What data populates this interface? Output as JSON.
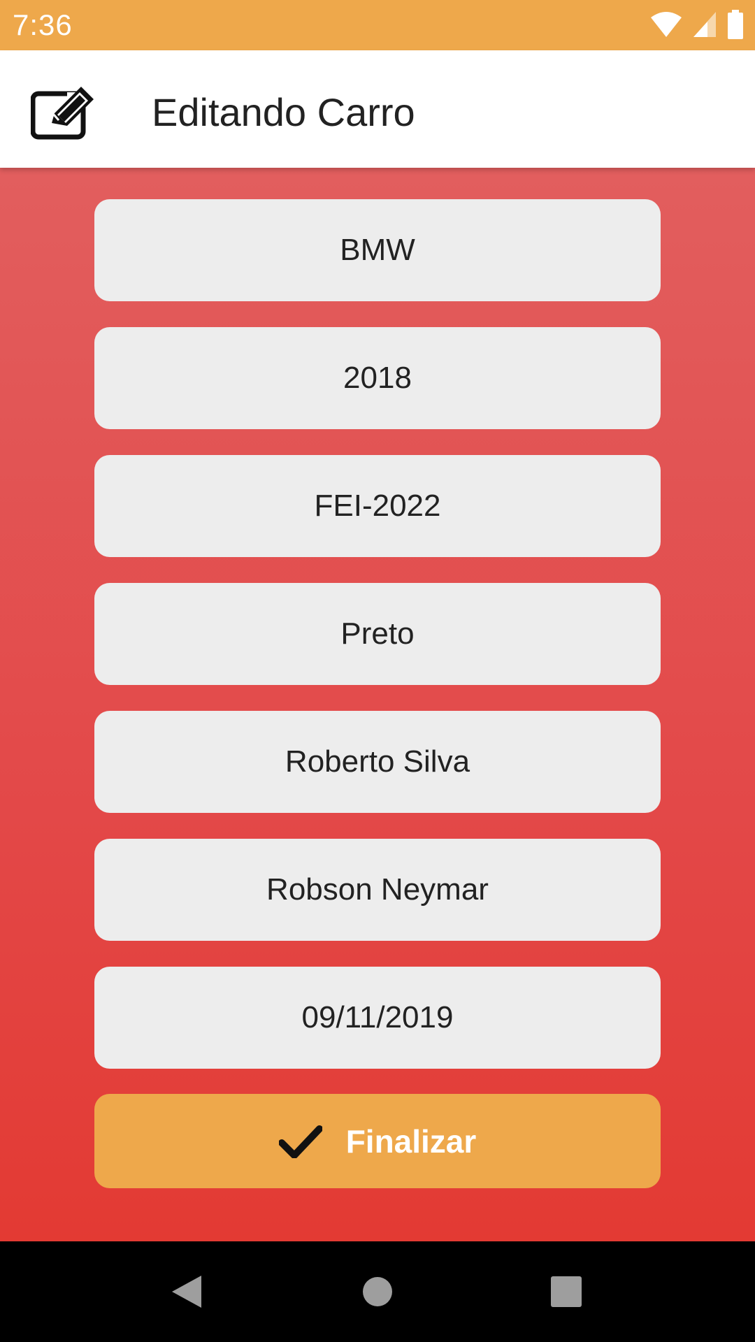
{
  "status_bar": {
    "time": "7:36"
  },
  "app_bar": {
    "title": "Editando Carro",
    "icon": "edit-icon"
  },
  "form": {
    "fields": [
      {
        "name": "brand-field",
        "value": "BMW"
      },
      {
        "name": "year-field",
        "value": "2018"
      },
      {
        "name": "plate-field",
        "value": "FEI-2022"
      },
      {
        "name": "color-field",
        "value": "Preto"
      },
      {
        "name": "owner-field",
        "value": "Roberto Silva"
      },
      {
        "name": "driver-field",
        "value": "Robson Neymar"
      },
      {
        "name": "date-field",
        "value": "09/11/2019"
      }
    ],
    "submit_label": "Finalizar",
    "submit_icon": "check-icon"
  },
  "colors": {
    "accent": "#EEA84B",
    "background_top": "#E25E5E",
    "background_bottom": "#E33A33",
    "field_bg": "#EDEDED"
  },
  "nav_bar": {
    "icons": [
      "back-icon",
      "home-icon",
      "recents-icon"
    ]
  }
}
